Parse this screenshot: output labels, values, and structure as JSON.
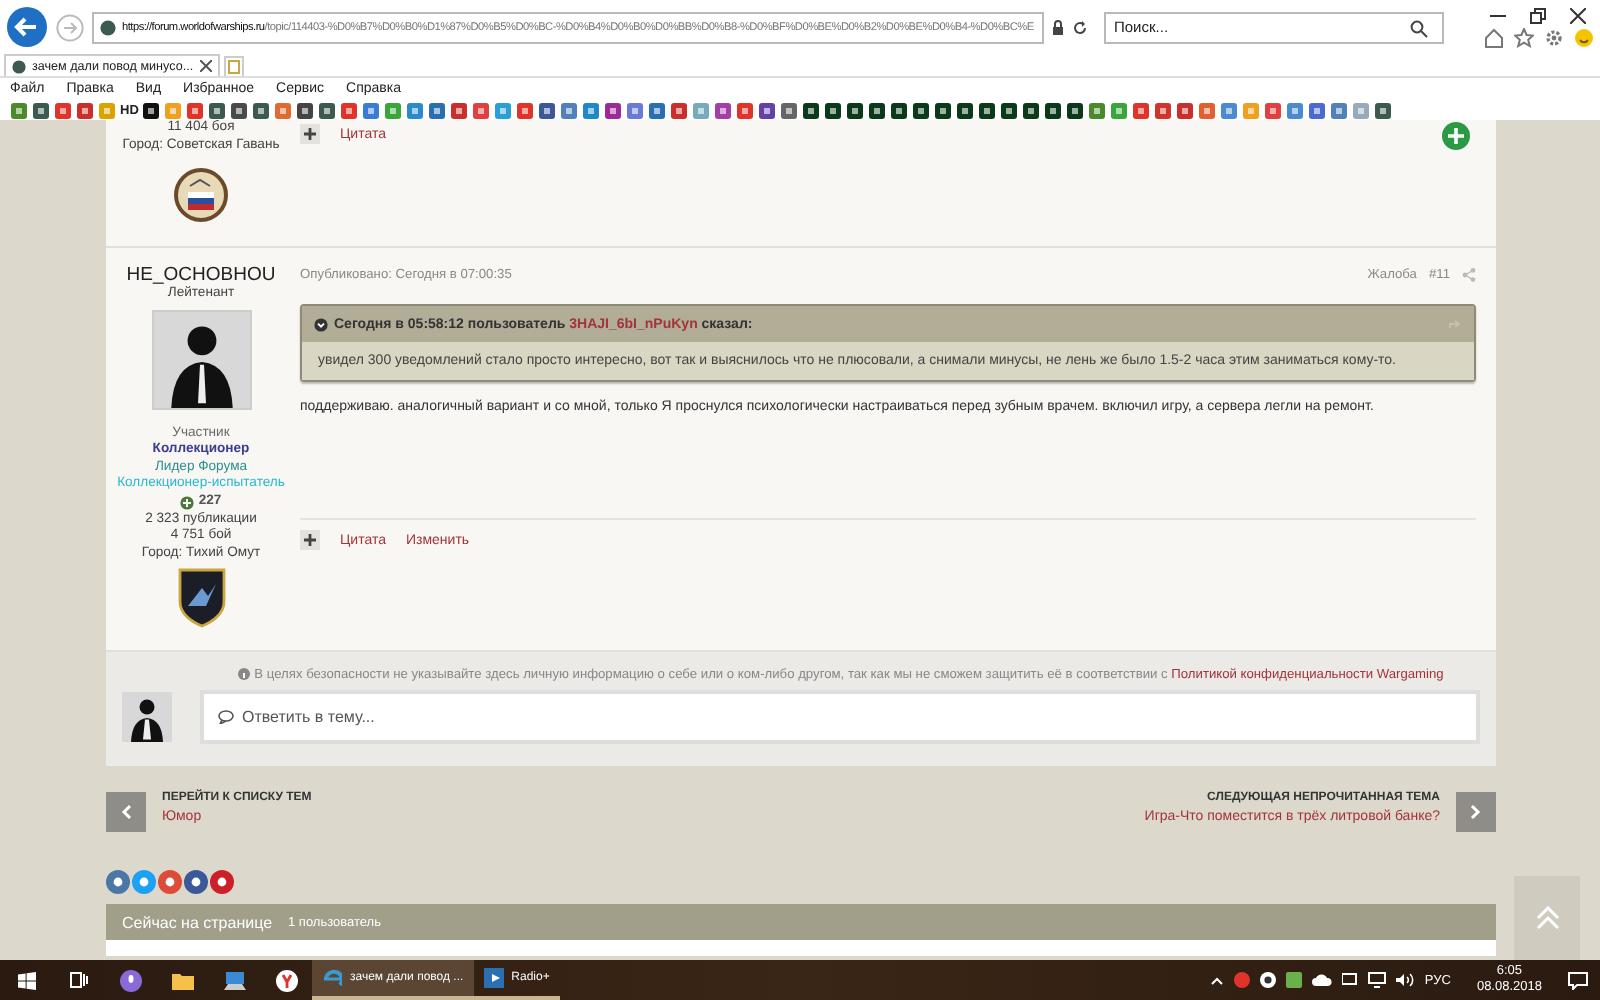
{
  "browser": {
    "url_scheme": "https://forum.",
    "url_domain": "worldofwarships.ru",
    "url_path": "/topic/114403-%D0%B7%D0%B0%D1%87%D0%B5%D0%BC-%D0%B4%D0%B0%D0%BB%D0%B8-%D0%BF%D0%BE%D0%B2%D0%BE%D0%B4-%D0%BC%E",
    "search_placeholder": "Поиск...",
    "tab_title": "зачем дали повод минусо...",
    "menu": [
      "Файл",
      "Правка",
      "Вид",
      "Избранное",
      "Сервис",
      "Справка"
    ],
    "favorites_label": "HD"
  },
  "previous_post": {
    "stats": [
      "11 404 боя",
      "Город: Советская Гавань"
    ],
    "actions": [
      "Цитата"
    ]
  },
  "post": {
    "author": "HE_OCHOBHOU",
    "rank": "Лейтенант",
    "groups": [
      {
        "name": "Участник",
        "color": "#6b6b6b"
      },
      {
        "name": "Коллекционер",
        "color": "#3b3b8f"
      },
      {
        "name": "Лидер Форума",
        "color": "#2a8f8f"
      },
      {
        "name": "Коллекционер-испытатель",
        "color": "#2ab8cc"
      }
    ],
    "reputation": "227",
    "stats": [
      "2 323 публикации",
      "4 751 бой",
      "Город: Тихий Омут"
    ],
    "posted": "Опубликовано: Сегодня в 07:00:35",
    "report": "Жалоба",
    "number": "#11",
    "quote": {
      "lead": "Сегодня в 05:58:12 пользователь",
      "author": "3HAJI_6bI_nPuKyn",
      "tail": "сказал:",
      "text": "увидел 300 уведомлений стало просто интересно, вот так и выяснилось что не плюсовали, а снимали минусы, не лень же было 1.5-2 часа этим заниматься кому-то."
    },
    "body": "поддерживаю. аналогичный вариант и со мной, только Я проснулся психологически настраиваться перед зубным врачем. включил игру, а сервера легли на ремонт.",
    "actions": [
      "Цитата",
      "Изменить"
    ]
  },
  "reply": {
    "notice": "В целях безопасности не указывайте здесь личную информацию о себе или о ком-либо другом, так как мы не сможем защитить её в соответствии с",
    "notice_link": "Политикой конфиденциальности Wargaming",
    "placeholder": "Ответить в тему..."
  },
  "navigation": {
    "previous": {
      "label": "ПЕРЕЙТИ К СПИСКУ ТЕМ",
      "title": "Юмор"
    },
    "next": {
      "label": "СЛЕДУЮЩАЯ НЕПРОЧИТАННАЯ ТЕМА",
      "title": "Игра-Что поместится в трёх литровой банке?"
    }
  },
  "online": {
    "title": "Сейчас на странице",
    "count": "1 пользователь"
  },
  "taskbar": {
    "tasks": [
      {
        "title": "зачем дали повод ...",
        "selected": true
      },
      {
        "title": "Radio+",
        "selected": false
      }
    ],
    "language": "РУС",
    "time": "6:05",
    "date": "08.08.2018"
  }
}
